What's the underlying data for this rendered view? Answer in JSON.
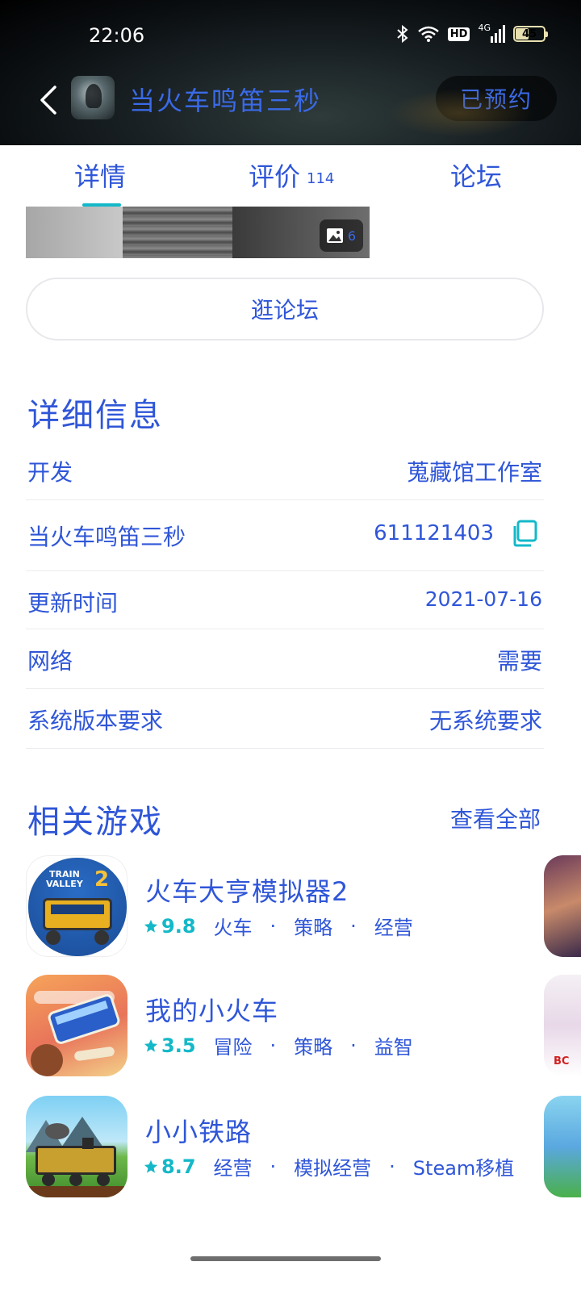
{
  "status_bar": {
    "time": "22:06",
    "hd": "HD",
    "network": "4G",
    "battery": "45",
    "battery_level": 0.45
  },
  "header": {
    "title": "当火车鸣笛三秒",
    "reserve_label": "已预约"
  },
  "tabs": [
    {
      "label": "详情",
      "count": ""
    },
    {
      "label": "评价",
      "count": "114"
    },
    {
      "label": "论坛",
      "count": ""
    }
  ],
  "image_strip": {
    "count": "6"
  },
  "forum_button": "逛论坛",
  "details": {
    "title": "详细信息",
    "rows": [
      {
        "key": "开发",
        "value": "蒐藏馆工作室"
      },
      {
        "key": "当火车鸣笛三秒",
        "value": "611121403"
      },
      {
        "key": "更新时间",
        "value": "2021-07-16"
      },
      {
        "key": "网络",
        "value": "需要"
      },
      {
        "key": "系统版本要求",
        "value": "无系统要求"
      }
    ]
  },
  "related": {
    "title": "相关游戏",
    "see_all": "查看全部",
    "games": [
      {
        "name": "火车大亨模拟器2",
        "rating": "9.8",
        "tags": [
          "火车",
          "策略",
          "经营"
        ],
        "icon_text_1": "TRAIN",
        "icon_text_2": "VALLEY",
        "icon_text_3": "2"
      },
      {
        "name": "我的小火车",
        "rating": "3.5",
        "tags": [
          "冒险",
          "策略",
          "益智"
        ]
      },
      {
        "name": "小小铁路",
        "rating": "8.7",
        "tags": [
          "经营",
          "模拟经营",
          "Steam移植"
        ]
      }
    ]
  },
  "colors": {
    "accent_text": "#2f56d8",
    "teal": "#14b8c8"
  }
}
